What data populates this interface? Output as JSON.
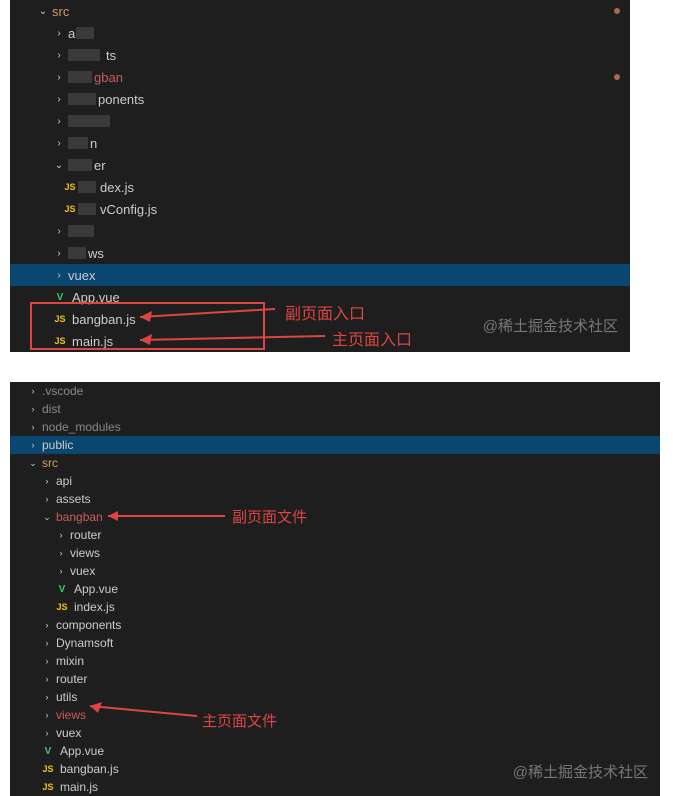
{
  "panel1": {
    "src": "src",
    "gban": "gban",
    "ponents": "ponents",
    "er": "er",
    "dexjs": "dex.js",
    "vconfig": "vConfig.js",
    "ws": "ws",
    "vuex": "vuex",
    "appvue": "App.vue",
    "bangbanjs": "bangban.js",
    "mainjs": "main.js",
    "a_prefix": "a",
    "ts_suffix": "ts",
    "n_suffix": "n"
  },
  "anno1": {
    "sub_entry": "副页面入口",
    "main_entry": "主页面入口"
  },
  "watermark": "@稀土掘金技术社区",
  "panel2": {
    "vscode": ".vscode",
    "dist": "dist",
    "node_modules": "node_modules",
    "public": "public",
    "src": "src",
    "api": "api",
    "assets": "assets",
    "bangban": "bangban",
    "router": "router",
    "views": "views",
    "vuex": "vuex",
    "appvue": "App.vue",
    "indexjs": "index.js",
    "components": "components",
    "dynamsoft": "Dynamsoft",
    "mixin": "mixin",
    "utils": "utils",
    "bangbanjs": "bangban.js",
    "mainjs": "main.js"
  },
  "anno2": {
    "sub_file": "副页面文件",
    "main_file": "主页面文件"
  }
}
